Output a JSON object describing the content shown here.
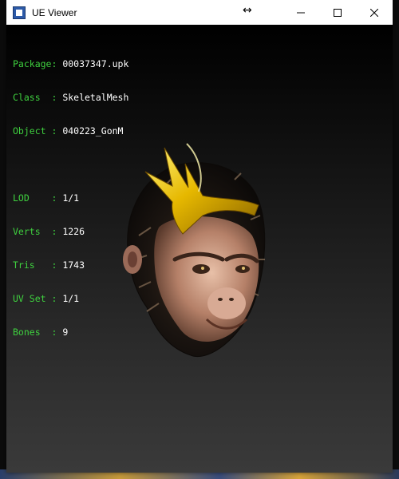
{
  "window": {
    "title": "UE Viewer",
    "resize_indicator": "↔"
  },
  "info": {
    "package": {
      "label": "Package: ",
      "value": "00037347.upk"
    },
    "class": {
      "label": "Class  : ",
      "value": "SkeletalMesh"
    },
    "object": {
      "label": "Object : ",
      "value": "040223_GonM"
    },
    "lod": {
      "label": "LOD    : ",
      "value": "1/1"
    },
    "verts": {
      "label": "Verts  : ",
      "value": "1226"
    },
    "tris": {
      "label": "Tris   : ",
      "value": "1743"
    },
    "uvset": {
      "label": "UV Set : ",
      "value": "1/1"
    },
    "bones": {
      "label": "Bones  : ",
      "value": "9"
    }
  },
  "colors": {
    "label_green": "#3fd13f",
    "value_white": "#ffffff",
    "viewport_bg": "#1a1a1a"
  },
  "icons": {
    "minimize": "minimize-icon",
    "maximize": "maximize-icon",
    "close": "close-icon",
    "app": "ue-viewer-app-icon"
  }
}
